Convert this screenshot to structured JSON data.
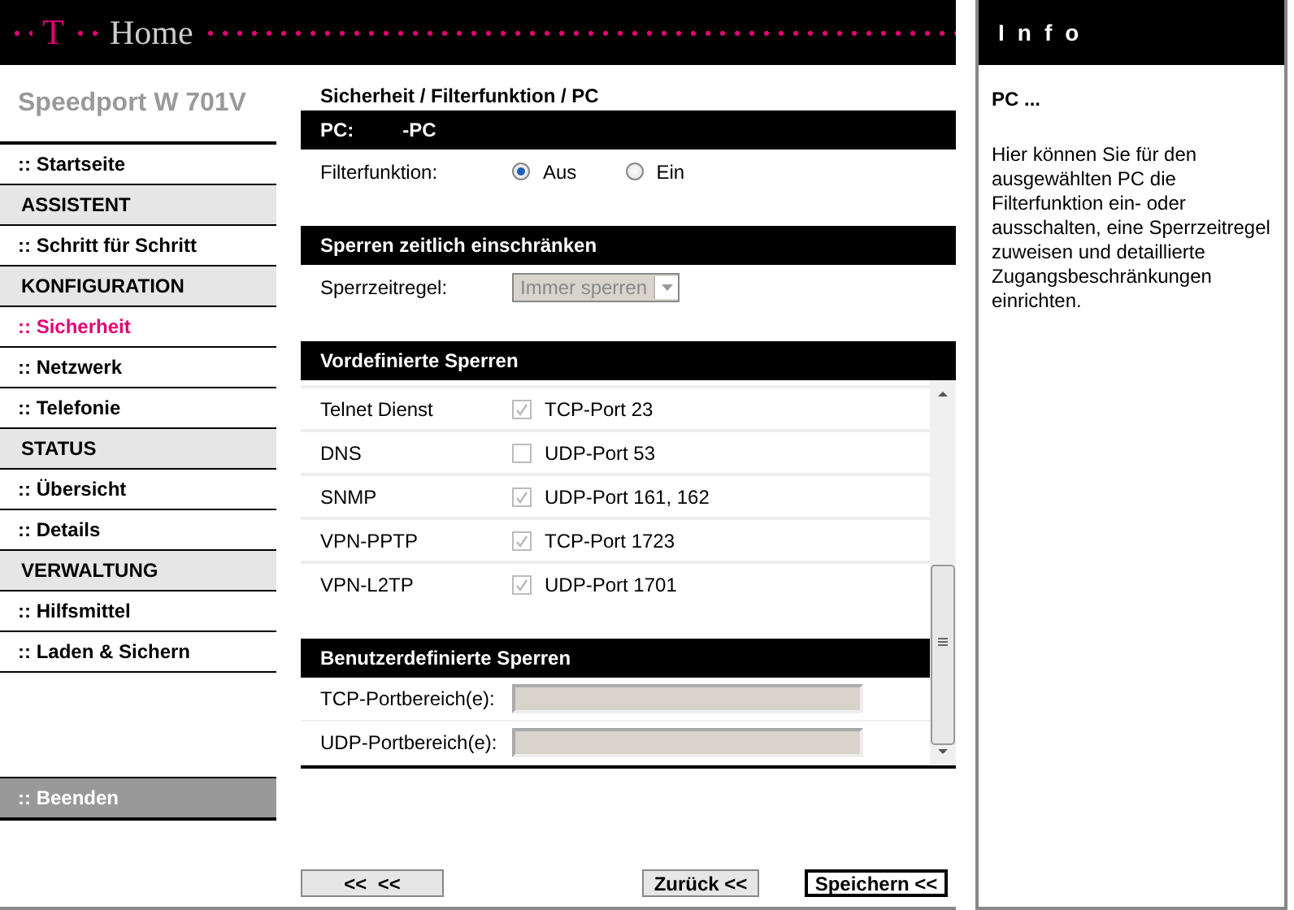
{
  "header": {
    "logo_mark": "T",
    "brand": "Home"
  },
  "sidebar": {
    "product": "Speedport W 701V",
    "items": [
      {
        "kind": "link",
        "label": ":: Startseite",
        "selected": false
      },
      {
        "kind": "section",
        "label": "ASSISTENT"
      },
      {
        "kind": "link",
        "label": ":: Schritt für Schritt",
        "selected": false
      },
      {
        "kind": "section",
        "label": "KONFIGURATION"
      },
      {
        "kind": "link",
        "label": ":: Sicherheit",
        "selected": true
      },
      {
        "kind": "link",
        "label": ":: Netzwerk",
        "selected": false
      },
      {
        "kind": "link",
        "label": ":: Telefonie",
        "selected": false
      },
      {
        "kind": "section",
        "label": "STATUS"
      },
      {
        "kind": "link",
        "label": ":: Übersicht",
        "selected": false
      },
      {
        "kind": "link",
        "label": ":: Details",
        "selected": false
      },
      {
        "kind": "section",
        "label": "VERWALTUNG"
      },
      {
        "kind": "link",
        "label": ":: Hilfsmittel",
        "selected": false
      },
      {
        "kind": "link",
        "label": ":: Laden & Sichern",
        "selected": false
      }
    ],
    "logout": ":: Beenden"
  },
  "main": {
    "breadcrumb": "Sicherheit / Filterfunktion / PC",
    "pc_bar": {
      "label": "PC:",
      "name": "-PC"
    },
    "filter": {
      "label": "Filterfunktion:",
      "options": [
        {
          "label": "Aus",
          "selected": true
        },
        {
          "label": "Ein",
          "selected": false
        }
      ]
    },
    "time_section": {
      "title": "Sperren zeitlich einschränken",
      "label": "Sperrzeitregel:",
      "select": {
        "value": "Immer sperren",
        "disabled": true
      }
    },
    "predefined": {
      "title": "Vordefinierte Sperren",
      "rows": [
        {
          "service": "Telnet Dienst",
          "checked": true,
          "port": "TCP-Port 23"
        },
        {
          "service": "DNS",
          "checked": false,
          "port": "UDP-Port 53"
        },
        {
          "service": "SNMP",
          "checked": true,
          "port": "UDP-Port 161, 162"
        },
        {
          "service": "VPN-PPTP",
          "checked": true,
          "port": "TCP-Port 1723"
        },
        {
          "service": "VPN-L2TP",
          "checked": true,
          "port": "UDP-Port 1701"
        }
      ]
    },
    "custom": {
      "title": "Benutzerdefinierte Sperren",
      "fields": [
        {
          "label": "TCP-Portbereich(e):",
          "disabled": true
        },
        {
          "label": "UDP-Portbereich(e):",
          "disabled": true
        }
      ]
    },
    "buttons": [
      {
        "label": "<<  <<",
        "kind": "normal"
      },
      {
        "label": "Zurück <<",
        "kind": "normal"
      },
      {
        "label": "Speichern <<",
        "kind": "default"
      }
    ]
  },
  "info": {
    "title": "Info",
    "heading": "PC ...",
    "text": "Hier können Sie für den ausgewählten PC die Filterfunktion ein- oder ausschalten, eine Sperrzeitregel zuweisen und detaillierte Zugangsbeschränkungen einrichten."
  }
}
